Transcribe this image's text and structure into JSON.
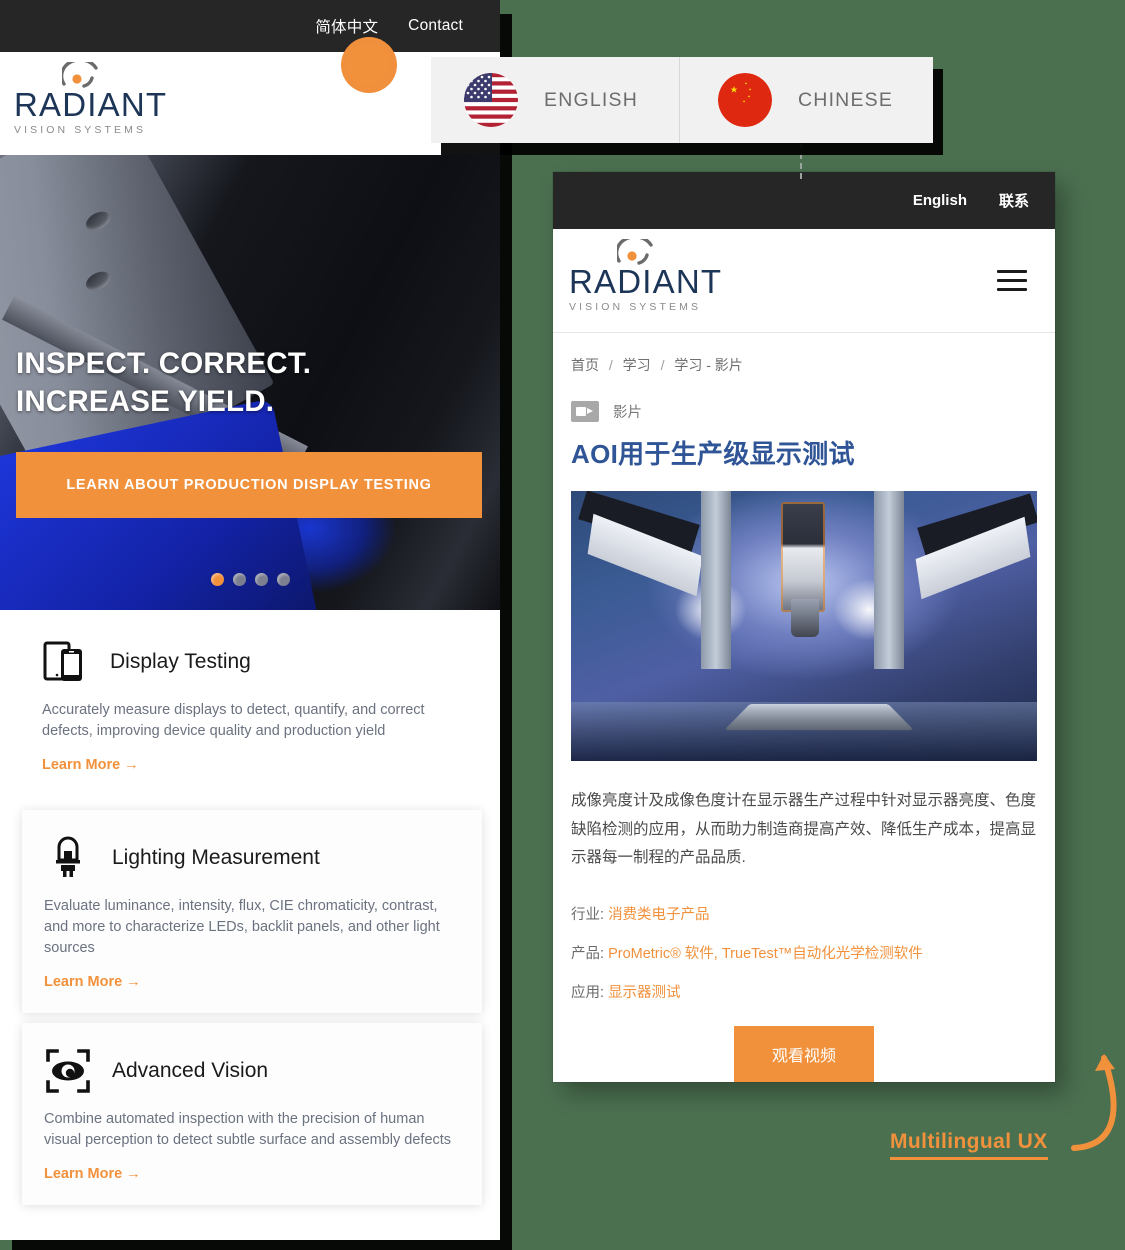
{
  "background_color": "#4b7050",
  "accent_color": "#f1913c",
  "english_site": {
    "topbar": {
      "language_link": "简体中文",
      "contact_link": "Contact"
    },
    "logo": {
      "word": "RADIANT",
      "sub": "VISION SYSTEMS"
    },
    "hero": {
      "title_line1": "INSPECT. CORRECT.",
      "title_line2": "INCREASE YIELD.",
      "cta_label": "LEARN ABOUT PRODUCTION DISPLAY TESTING",
      "slide_count": 4,
      "active_slide": 1
    },
    "features": [
      {
        "icon": "tablet-phone-icon",
        "title": "Display Testing",
        "description": "Accurately measure displays to detect, quantify, and correct defects, improving device quality and production yield",
        "link_label": "Learn More →"
      },
      {
        "icon": "light-bulb-icon",
        "title": "Lighting Measurement",
        "description": "Evaluate luminance, intensity, flux, CIE chromaticity, contrast, and more to characterize LEDs, backlit panels, and other light sources",
        "link_label": "Learn More →"
      },
      {
        "icon": "eye-bracket-icon",
        "title": "Advanced Vision",
        "description": "Combine automated inspection with the precision of human visual perception to detect subtle surface and assembly defects",
        "link_label": "Learn More →"
      }
    ]
  },
  "language_popup": {
    "options": [
      {
        "flag": "us-flag-icon",
        "label": "ENGLISH"
      },
      {
        "flag": "china-flag-icon",
        "label": "CHINESE"
      }
    ]
  },
  "chinese_site": {
    "topbar": {
      "language_link": "English",
      "contact_link": "联系"
    },
    "logo": {
      "word": "RADIANT",
      "sub": "VISION SYSTEMS"
    },
    "menu_icon": "hamburger-menu-icon",
    "breadcrumb": [
      "首页",
      "学习",
      "学习 - 影片"
    ],
    "badge": {
      "icon": "video-camera-icon",
      "label": "影片"
    },
    "title": "AOI用于生产级显示测试",
    "thumbnail_alt": "display inspection machine",
    "paragraph": "成像亮度计及成像色度计在显示器生产过程中针对显示器亮度、色度缺陷检测的应用，从而助力制造商提高产效、降低生产成本，提高显示器每一制程的产品品质.",
    "meta": [
      {
        "label": "行业:",
        "value": "消费类电子产品"
      },
      {
        "label": "产品:",
        "value": "ProMetric® 软件, TrueTest™自动化光学检测软件"
      },
      {
        "label": "应用:",
        "value": "显示器测试"
      }
    ],
    "button_label": "观看视频"
  },
  "annotation": {
    "text": "Multilingual UX",
    "arrow": "curved-arrow-icon"
  }
}
